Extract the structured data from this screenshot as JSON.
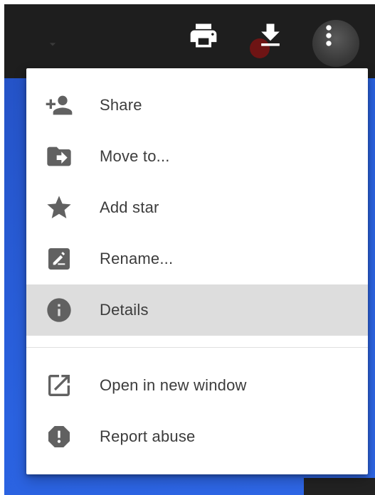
{
  "toolbar": {
    "dropdown_icon": "caret-down-icon",
    "print_icon": "print-icon",
    "download_icon": "download-icon",
    "more_icon": "more-vert-icon"
  },
  "menu": {
    "items": [
      {
        "label": "Share",
        "icon": "person-add-icon"
      },
      {
        "label": "Move to...",
        "icon": "folder-move-icon"
      },
      {
        "label": "Add star",
        "icon": "star-icon"
      },
      {
        "label": "Rename...",
        "icon": "rename-icon"
      },
      {
        "label": "Details",
        "icon": "info-icon",
        "active": true
      }
    ],
    "secondary_items": [
      {
        "label": "Open in new window",
        "icon": "open-in-new-icon"
      },
      {
        "label": "Report abuse",
        "icon": "report-icon"
      }
    ]
  },
  "colors": {
    "icon": "#616161",
    "text": "#3c3c3c",
    "hover": "#dddddd",
    "toolbar_bg": "#1e1e1e",
    "background_blue": "#2a62e0"
  }
}
